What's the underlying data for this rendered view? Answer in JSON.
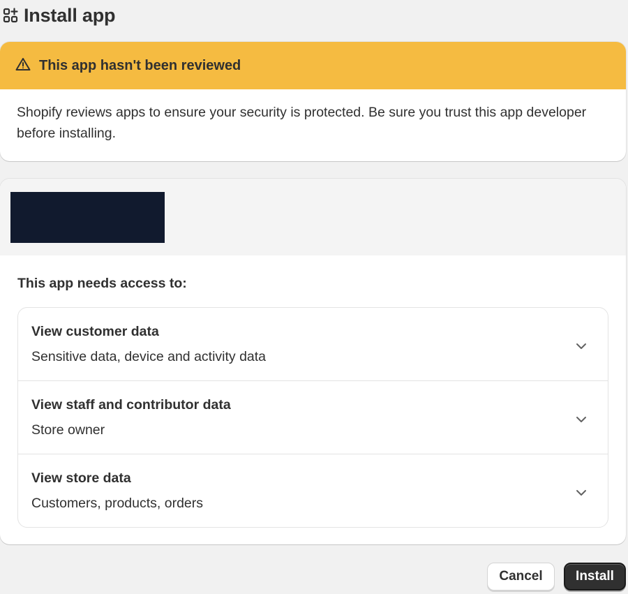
{
  "header": {
    "icon": "apps-grid-add-icon",
    "title": "Install app"
  },
  "warning": {
    "icon": "alert-triangle-icon",
    "title": "This app hasn't been reviewed",
    "body": "Shopify reviews apps to ensure your security is protected. Be sure you trust this app developer before installing.",
    "banner_color": "#f5bb41"
  },
  "access": {
    "app_logo_color": "#111a2e",
    "heading": "This app needs access to:",
    "permissions": [
      {
        "title": "View customer data",
        "description": "Sensitive data, device and activity data",
        "icon": "chevron-down-icon"
      },
      {
        "title": "View staff and contributor data",
        "description": "Store owner",
        "icon": "chevron-down-icon"
      },
      {
        "title": "View store data",
        "description": "Customers, products, orders",
        "icon": "chevron-down-icon"
      }
    ]
  },
  "footer": {
    "cancel_label": "Cancel",
    "install_label": "Install",
    "install_color": "#303030"
  }
}
